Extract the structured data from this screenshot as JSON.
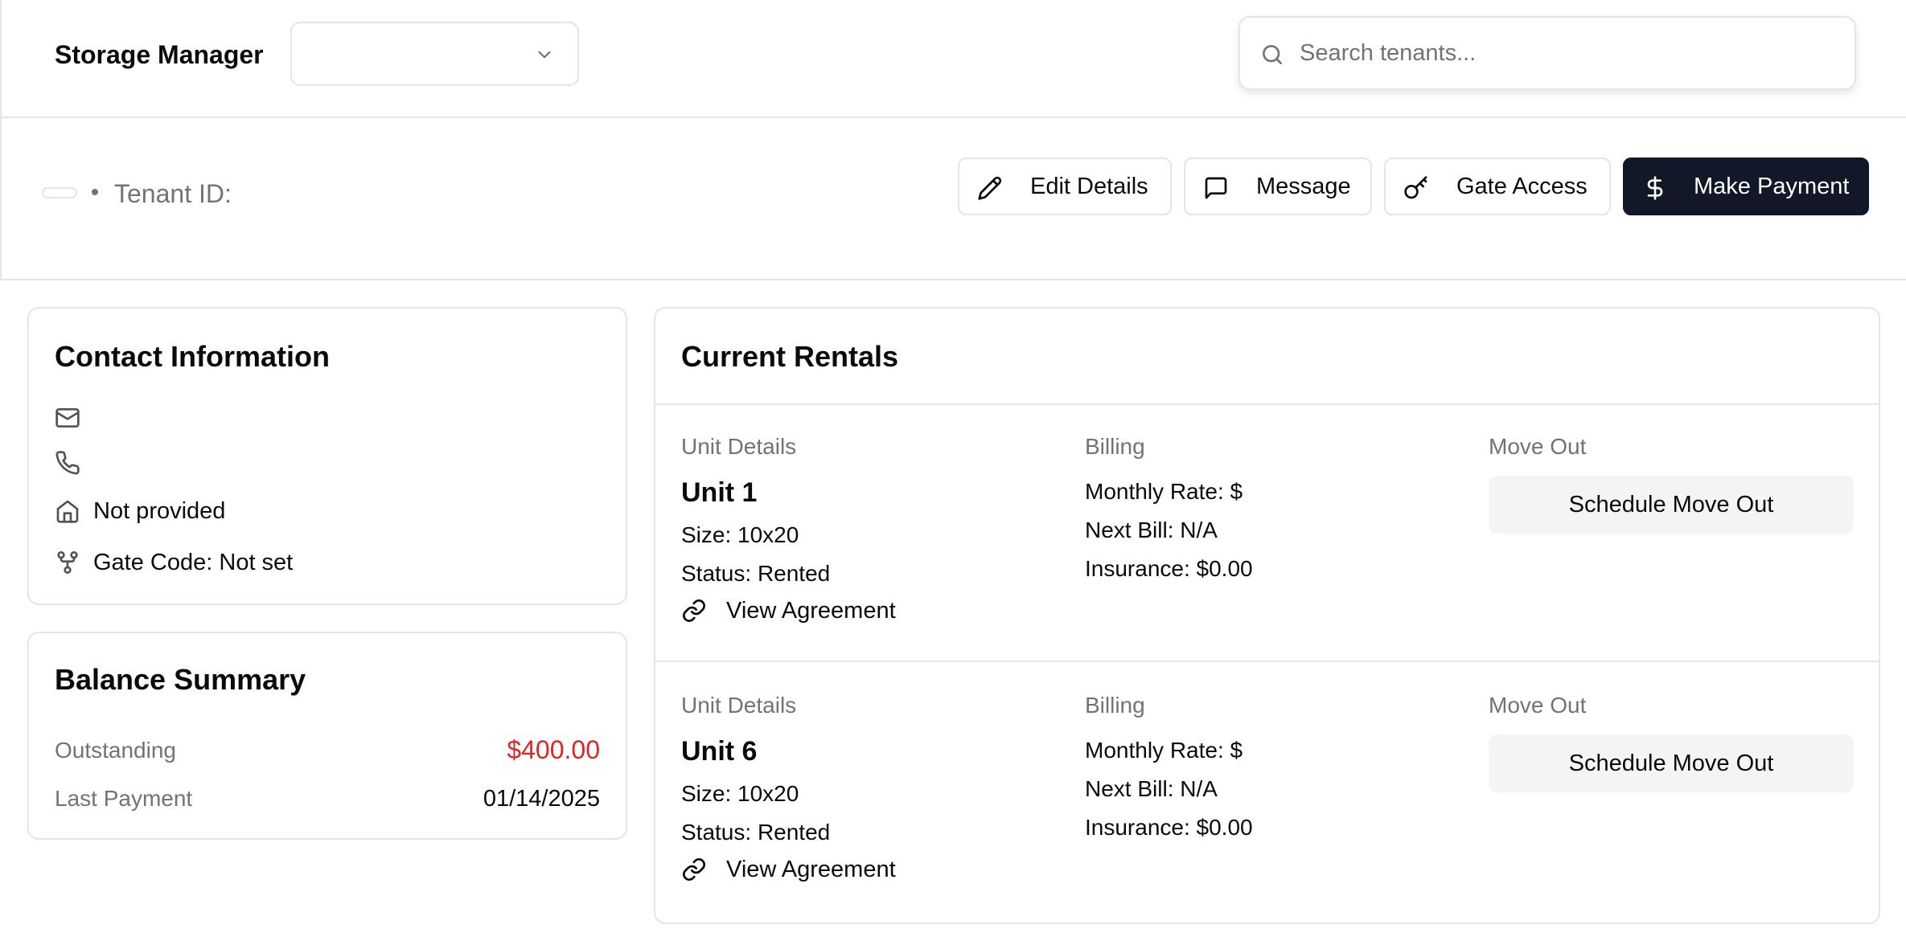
{
  "header": {
    "app_title": "Storage Manager",
    "facility_select": {
      "value": ""
    },
    "search": {
      "placeholder": "Search tenants...",
      "value": ""
    }
  },
  "tenant": {
    "name": "",
    "id_label": "Tenant ID:",
    "id_value": "",
    "actions": {
      "edit": "Edit Details",
      "message": "Message",
      "gate": "Gate Access",
      "payment": "Make Payment"
    }
  },
  "contact": {
    "title": "Contact Information",
    "email": "",
    "phone": "",
    "address": "Not provided",
    "gate_code": "Gate Code: Not set"
  },
  "balance": {
    "title": "Balance Summary",
    "outstanding_label": "Outstanding",
    "outstanding_value": "$400.00",
    "last_payment_label": "Last Payment",
    "last_payment_value": "01/14/2025"
  },
  "rentals": {
    "title": "Current Rentals",
    "col_unit": "Unit Details",
    "col_billing": "Billing",
    "col_moveout": "Move Out",
    "items": [
      {
        "unit": "Unit 1",
        "size": "Size: 10x20",
        "status": "Status: Rented",
        "agreement": "View Agreement",
        "monthly_rate": "Monthly Rate: $",
        "next_bill": "Next Bill: N/A",
        "insurance": "Insurance: $0.00",
        "move_out_button": "Schedule Move Out"
      },
      {
        "unit": "Unit 6",
        "size": "Size: 10x20",
        "status": "Status: Rented",
        "agreement": "View Agreement",
        "monthly_rate": "Monthly Rate: $",
        "next_bill": "Next Bill: N/A",
        "insurance": "Insurance: $0.00",
        "move_out_button": "Schedule Move Out"
      }
    ]
  },
  "colors": {
    "primary_button": "#111827",
    "negative_balance": "#dc2626",
    "muted_text": "#737373",
    "border": "#e5e5e5"
  },
  "icons": {
    "select": "chevron-down-icon",
    "search": "search-icon",
    "edit": "pencil-icon",
    "message": "message-square-icon",
    "gate": "key-icon",
    "payment": "dollar-sign-icon",
    "email": "mail-icon",
    "phone": "phone-icon",
    "address": "home-icon",
    "gate_code": "git-fork-icon",
    "agreement": "link-icon"
  }
}
